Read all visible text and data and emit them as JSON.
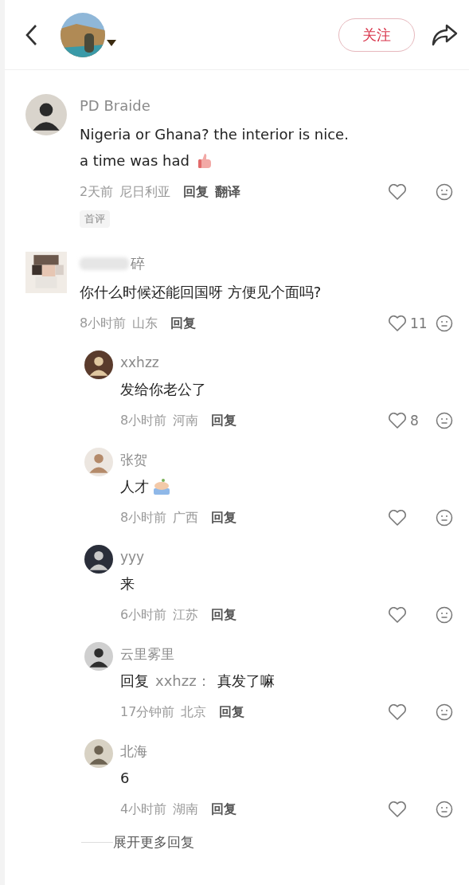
{
  "header": {
    "follow_button": "关注"
  },
  "comments": [
    {
      "name": "PD Braide",
      "obscured": false,
      "lines": [
        "Nigeria or Ghana? the interior is nice.",
        "a time was had"
      ],
      "sticker": true,
      "time": "2天前",
      "region": "尼日利亚",
      "actions": [
        "回复",
        "翻译"
      ],
      "liked": false,
      "tag": "首评"
    },
    {
      "name": "碎",
      "obscured": true,
      "lines": [
        "你什么时候还能回国呀 方便见个面吗?"
      ],
      "time": "8小时前",
      "region": "山东",
      "actions": [
        "回复"
      ],
      "liked": false,
      "likes": "11",
      "replies": [
        {
          "name": "xxhzz",
          "text": "发给你老公了",
          "time": "8小时前",
          "region": "河南",
          "action": "回复",
          "liked": false,
          "likes": "8"
        },
        {
          "name": "张贺",
          "text": "人才",
          "sticker": true,
          "time": "8小时前",
          "region": "广西",
          "action": "回复",
          "liked": false
        },
        {
          "name": "yyy",
          "text": "来",
          "time": "6小时前",
          "region": "江苏",
          "action": "回复",
          "liked": false
        },
        {
          "name": "云里雾里",
          "reply_label": "回复",
          "reply_to": "xxhzz：",
          "text": "真发了嘛",
          "time": "17分钟前",
          "region": "北京",
          "action": "回复",
          "liked": false
        },
        {
          "name": "北海",
          "text": "6",
          "time": "4小时前",
          "region": "湖南",
          "action": "回复",
          "liked": false
        }
      ],
      "expand": "展开更多回复"
    }
  ]
}
